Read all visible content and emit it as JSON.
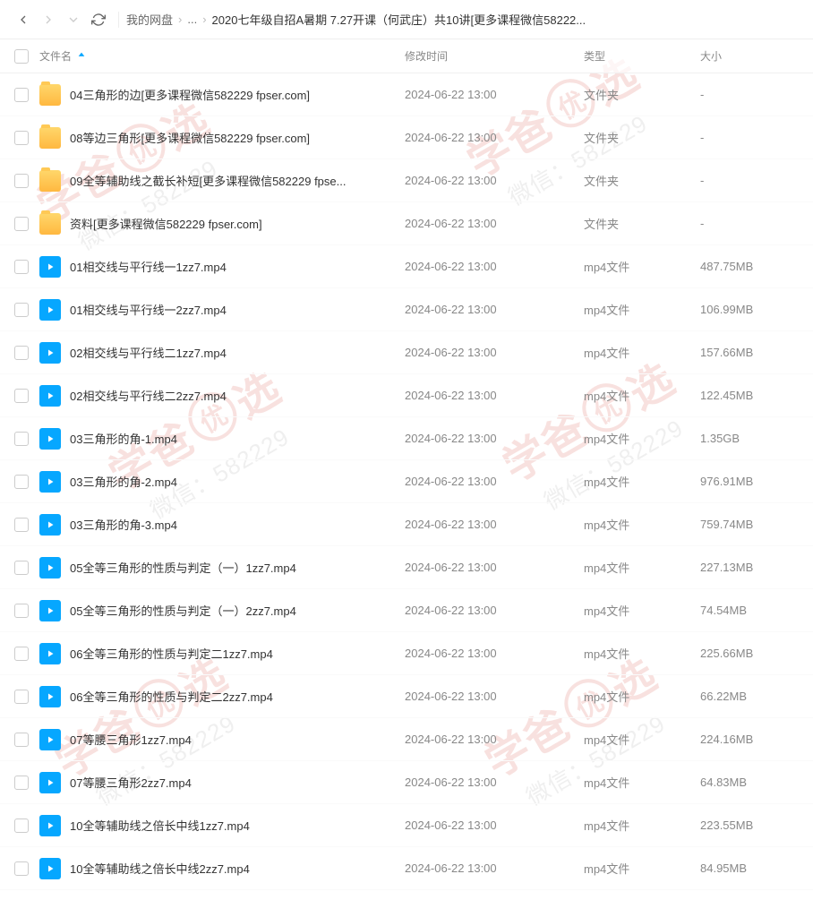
{
  "toolbar": {
    "breadcrumb": {
      "root": "我的网盘",
      "ellipsis": "...",
      "current": "2020七年级自招A暑期 7.27开课（何武庄）共10讲[更多课程微信58222..."
    }
  },
  "columns": {
    "name": "文件名",
    "modified": "修改时间",
    "type": "类型",
    "size": "大小"
  },
  "watermark": {
    "brand": "学爸",
    "brandCircle": "优",
    "brandSuffix": "选",
    "contact": "微信：582229"
  },
  "files": [
    {
      "name": "04三角形的边[更多课程微信582229 fpser.com]",
      "time": "2024-06-22 13:00",
      "type": "文件夹",
      "size": "-",
      "kind": "folder"
    },
    {
      "name": "08等边三角形[更多课程微信582229 fpser.com]",
      "time": "2024-06-22 13:00",
      "type": "文件夹",
      "size": "-",
      "kind": "folder"
    },
    {
      "name": "09全等辅助线之截长补短[更多课程微信582229 fpse...",
      "time": "2024-06-22 13:00",
      "type": "文件夹",
      "size": "-",
      "kind": "folder"
    },
    {
      "name": "资料[更多课程微信582229 fpser.com]",
      "time": "2024-06-22 13:00",
      "type": "文件夹",
      "size": "-",
      "kind": "folder"
    },
    {
      "name": "01相交线与平行线一1zz7.mp4",
      "time": "2024-06-22 13:00",
      "type": "mp4文件",
      "size": "487.75MB",
      "kind": "video"
    },
    {
      "name": "01相交线与平行线一2zz7.mp4",
      "time": "2024-06-22 13:00",
      "type": "mp4文件",
      "size": "106.99MB",
      "kind": "video"
    },
    {
      "name": "02相交线与平行线二1zz7.mp4",
      "time": "2024-06-22 13:00",
      "type": "mp4文件",
      "size": "157.66MB",
      "kind": "video"
    },
    {
      "name": "02相交线与平行线二2zz7.mp4",
      "time": "2024-06-22 13:00",
      "type": "mp4文件",
      "size": "122.45MB",
      "kind": "video"
    },
    {
      "name": "03三角形的角-1.mp4",
      "time": "2024-06-22 13:00",
      "type": "mp4文件",
      "size": "1.35GB",
      "kind": "video"
    },
    {
      "name": "03三角形的角-2.mp4",
      "time": "2024-06-22 13:00",
      "type": "mp4文件",
      "size": "976.91MB",
      "kind": "video"
    },
    {
      "name": "03三角形的角-3.mp4",
      "time": "2024-06-22 13:00",
      "type": "mp4文件",
      "size": "759.74MB",
      "kind": "video"
    },
    {
      "name": "05全等三角形的性质与判定（一）1zz7.mp4",
      "time": "2024-06-22 13:00",
      "type": "mp4文件",
      "size": "227.13MB",
      "kind": "video"
    },
    {
      "name": "05全等三角形的性质与判定（一）2zz7.mp4",
      "time": "2024-06-22 13:00",
      "type": "mp4文件",
      "size": "74.54MB",
      "kind": "video"
    },
    {
      "name": "06全等三角形的性质与判定二1zz7.mp4",
      "time": "2024-06-22 13:00",
      "type": "mp4文件",
      "size": "225.66MB",
      "kind": "video"
    },
    {
      "name": "06全等三角形的性质与判定二2zz7.mp4",
      "time": "2024-06-22 13:00",
      "type": "mp4文件",
      "size": "66.22MB",
      "kind": "video"
    },
    {
      "name": "07等腰三角形1zz7.mp4",
      "time": "2024-06-22 13:00",
      "type": "mp4文件",
      "size": "224.16MB",
      "kind": "video"
    },
    {
      "name": "07等腰三角形2zz7.mp4",
      "time": "2024-06-22 13:00",
      "type": "mp4文件",
      "size": "64.83MB",
      "kind": "video"
    },
    {
      "name": "10全等辅助线之倍长中线1zz7.mp4",
      "time": "2024-06-22 13:00",
      "type": "mp4文件",
      "size": "223.55MB",
      "kind": "video"
    },
    {
      "name": "10全等辅助线之倍长中线2zz7.mp4",
      "time": "2024-06-22 13:00",
      "type": "mp4文件",
      "size": "84.95MB",
      "kind": "video"
    }
  ]
}
